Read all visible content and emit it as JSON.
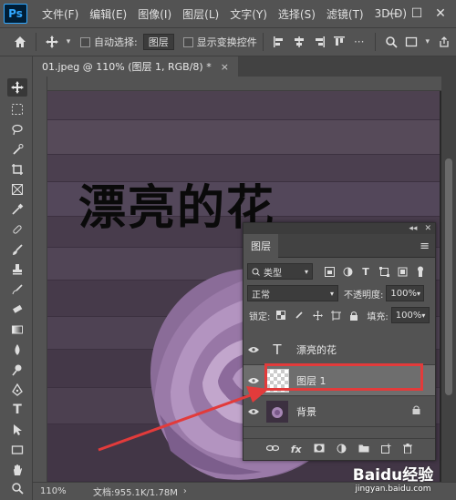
{
  "app": {
    "logo": "Ps"
  },
  "menubar": {
    "items": [
      "文件(F)",
      "编辑(E)",
      "图像(I)",
      "图层(L)",
      "文字(Y)",
      "选择(S)",
      "滤镜(T)",
      "3D(D)"
    ],
    "minimize": "—",
    "maximize": "☐",
    "close": "✕"
  },
  "options": {
    "auto_select_label": "自动选择:",
    "auto_select_value": "图层",
    "show_transform_label": "显示变换控件",
    "more": "···"
  },
  "document": {
    "tab_title": "01.jpeg @ 110% (图层 1, RGB/8) *",
    "close": "×",
    "headline": "漂亮的花"
  },
  "layers_panel": {
    "title": "图层",
    "filter_kind": "类型",
    "blend_mode": "正常",
    "opacity_label": "不透明度:",
    "opacity_value": "100%",
    "lock_label": "锁定:",
    "fill_label": "填充:",
    "fill_value": "100%",
    "layers": [
      {
        "name": "漂亮的花",
        "kind": "text",
        "thumb": "T",
        "selected": false
      },
      {
        "name": "图层 1",
        "kind": "pixel",
        "selected": true
      },
      {
        "name": "背景",
        "kind": "image",
        "locked": true,
        "selected": false
      }
    ],
    "footer_icons": [
      "link-icon",
      "fx-icon",
      "mask-icon",
      "adjustment-icon",
      "folder-icon",
      "new-layer-icon",
      "trash-icon"
    ],
    "fx_label": "fx"
  },
  "statusbar": {
    "zoom": "110%",
    "docinfo": "文档:955.1K/1.78M",
    "arrow": "›"
  },
  "watermark": {
    "logo": "Baidu经验",
    "url": "jingyan.baidu.com"
  },
  "colors": {
    "panel_bg": "#535353",
    "highlight": "#e23b3b",
    "selected_layer": "#6e6e6e"
  }
}
